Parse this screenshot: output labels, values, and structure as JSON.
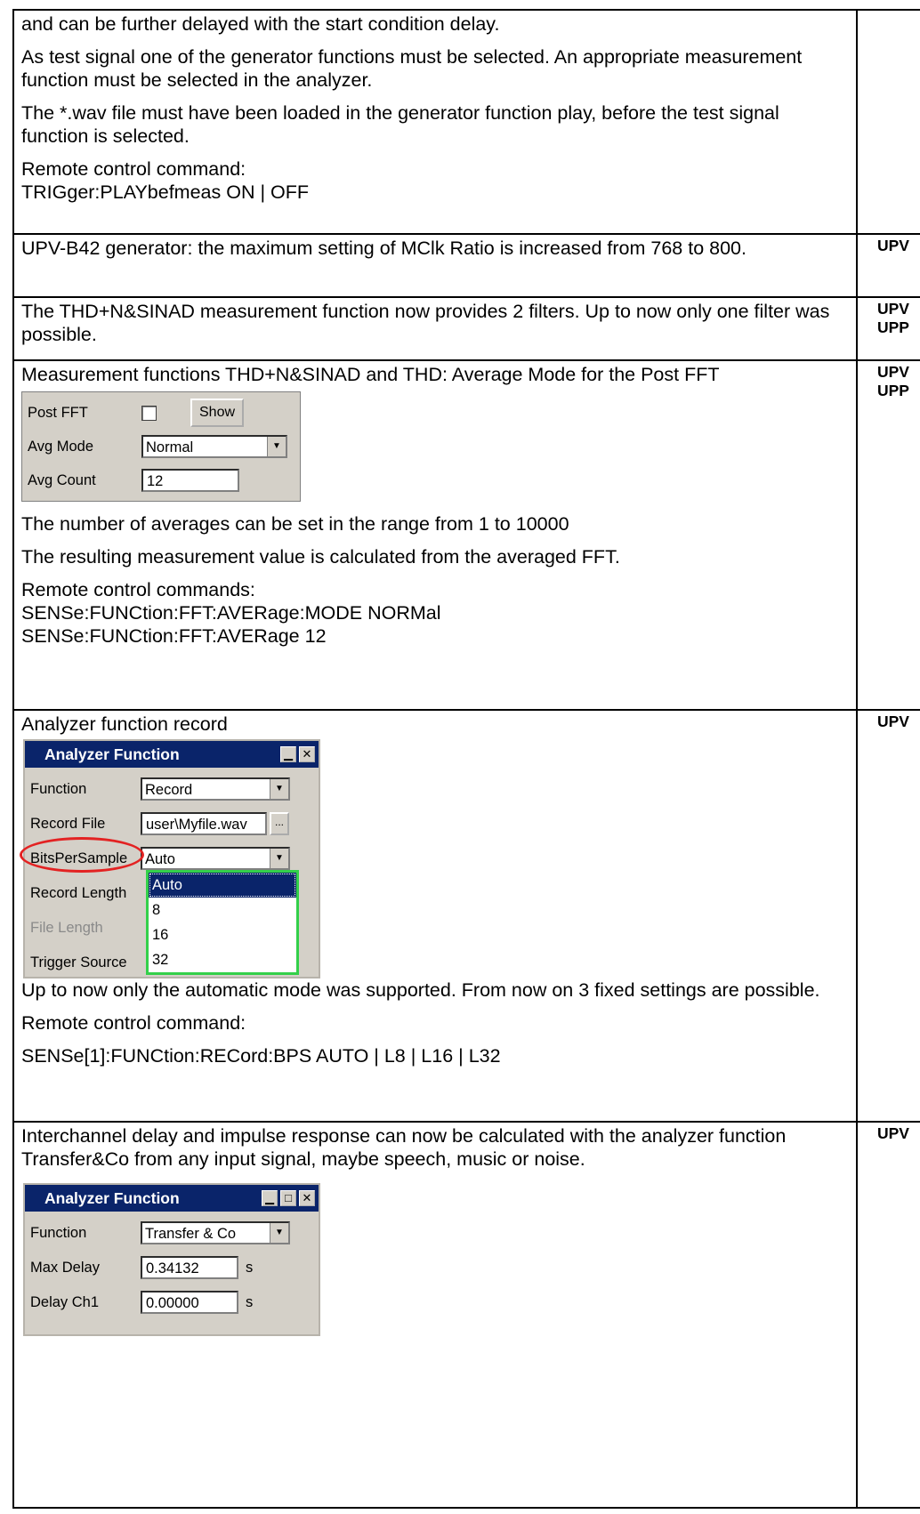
{
  "rows": [
    {
      "paragraphs": [
        "and can be further delayed with the start condition delay.",
        "As test signal one of the generator functions must be selected. An appropriate measurement function must be selected in the analyzer.",
        "The *.wav file must have been loaded in the generator function play, before the test signal function is selected."
      ],
      "remote_label": "Remote control command:",
      "remote_commands": [
        "TRIGger:PLAYbefmeas ON | OFF"
      ],
      "tags": []
    },
    {
      "paragraphs": [
        "UPV-B42 generator: the maximum setting of MClk Ratio is increased from 768 to 800."
      ],
      "tags": [
        "UPV"
      ]
    },
    {
      "paragraphs": [
        "The THD+N&SINAD measurement function now provides 2 filters. Up to now only one filter was possible."
      ],
      "tags": [
        "UPV",
        "UPP"
      ]
    },
    {
      "intro": "Measurement functions THD+N&SINAD and THD: Average Mode for the Post FFT",
      "panel": {
        "post_fft_label": "Post FFT",
        "show_button": "Show",
        "avg_mode_label": "Avg Mode",
        "avg_mode_value": "Normal",
        "avg_count_label": "Avg Count",
        "avg_count_value": "12"
      },
      "paragraphs": [
        "The number of averages can be set in the range from 1 to 10000",
        "The resulting measurement value is calculated from the averaged FFT."
      ],
      "remote_label": "Remote control commands:",
      "remote_commands": [
        "SENSe:FUNCtion:FFT:AVERage:MODE NORMal",
        "SENSe:FUNCtion:FFT:AVERage 12"
      ],
      "tags": [
        "UPV",
        "UPP"
      ]
    },
    {
      "intro": "Analyzer function record",
      "window": {
        "title": "Analyzer Function",
        "function_label": "Function",
        "function_value": "Record",
        "record_file_label": "Record File",
        "record_file_value": "user\\Myfile.wav",
        "browse": "...",
        "bits_label": "BitsPerSample",
        "bits_value": "Auto",
        "record_length_label": "Record Length",
        "file_length_label": "File Length",
        "trigger_source_label": "Trigger Source",
        "options": [
          "Auto",
          "8",
          "16",
          "32"
        ]
      },
      "paragraphs": [
        "Up to now only the automatic mode was supported. From now on 3 fixed settings are possible."
      ],
      "remote_label": "Remote control command:",
      "remote_commands": [
        "SENSe[1]:FUNCtion:RECord:BPS AUTO | L8 | L16 | L32"
      ],
      "tags": [
        "UPV"
      ]
    },
    {
      "intro": "Interchannel delay and impulse response can now be calculated with the analyzer function Transfer&Co from any input signal, maybe speech, music or noise.",
      "window": {
        "title": "Analyzer Function",
        "function_label": "Function",
        "function_value": "Transfer & Co",
        "max_delay_label": "Max Delay",
        "max_delay_value": "0.34132",
        "delay_ch1_label": "Delay Ch1",
        "delay_ch1_value": "0.00000",
        "unit": "s"
      },
      "tags": [
        "UPV"
      ]
    }
  ]
}
